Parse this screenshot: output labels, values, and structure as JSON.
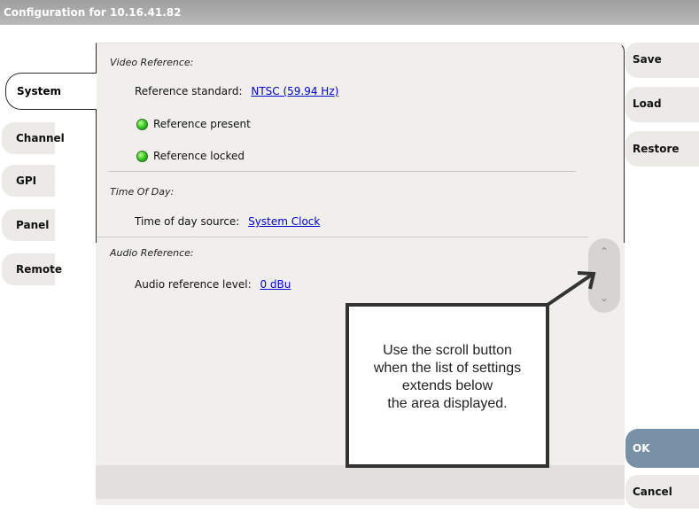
{
  "window": {
    "title": "Configuration for 10.16.41.82"
  },
  "tabs": [
    {
      "label": "System",
      "active": true
    },
    {
      "label": "Channel"
    },
    {
      "label": "GPI"
    },
    {
      "label": "Panel"
    },
    {
      "label": "Remote"
    }
  ],
  "actions": {
    "save": "Save",
    "load": "Load",
    "restore": "Restore",
    "ok": "OK",
    "cancel": "Cancel"
  },
  "video_reference": {
    "title": "Video Reference:",
    "standard_label": "Reference standard:",
    "standard_value": "NTSC (59.94 Hz)",
    "present_label": "Reference present",
    "locked_label": "Reference locked"
  },
  "time_of_day": {
    "title": "Time Of Day:",
    "source_label": "Time of day source:",
    "source_value": "System Clock"
  },
  "audio_reference": {
    "title": "Audio Reference:",
    "level_label": "Audio reference level:",
    "level_value": "0 dBu"
  },
  "callout": {
    "line1": "Use the scroll button",
    "line2": "when the list of settings",
    "line3": "extends below",
    "line4": "the area displayed."
  },
  "colors": {
    "link": "#0000cc",
    "led_on": "#2fc01c",
    "ok_button": "#7991a6",
    "titlebar": "#a8a8a8"
  }
}
